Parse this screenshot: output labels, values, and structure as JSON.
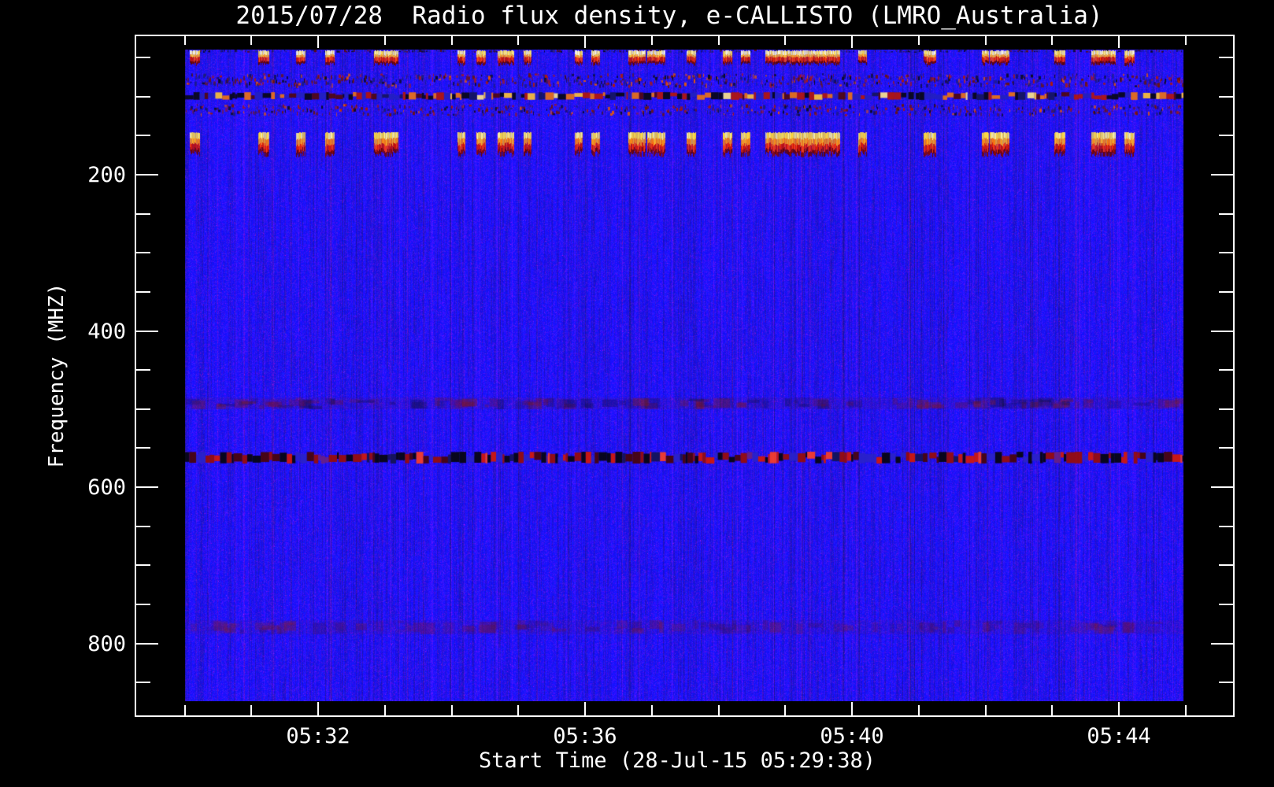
{
  "title": "2015/07/28  Radio flux density, e-CALLISTO (LMRO_Australia)",
  "axes": {
    "x": {
      "label": "Start Time (28-Jul-15 05:29:38)",
      "start_time": "05:29:38",
      "major_tick_labels": [
        "05:32",
        "05:36",
        "05:40",
        "05:44"
      ],
      "minor_tick_interval_min": 1,
      "major_tick_interval_min": 4
    },
    "y": {
      "label": "Frequency (MHZ)",
      "major_tick_labels": [
        "200",
        "400",
        "600",
        "800"
      ],
      "major_ticks_mhz": [
        200,
        400,
        600,
        800
      ],
      "minor_tick_step_mhz": 50,
      "direction": "frequency increases downward"
    }
  },
  "chart_data": {
    "type": "heatmap",
    "title": "2015/07/28  Radio flux density, e-CALLISTO (LMRO_Australia)",
    "xlabel": "Start Time (28-Jul-15 05:29:38)",
    "ylabel": "Frequency (MHZ)",
    "x_range": [
      "05:29:38",
      "05:45:15"
    ],
    "y_range_mhz": [
      40,
      874
    ],
    "x_ticks": [
      "05:32",
      "05:36",
      "05:40",
      "05:44"
    ],
    "y_ticks_mhz": [
      200,
      400,
      600,
      800
    ],
    "legend": "none",
    "grid": "off",
    "colormap": "blue (quiet) -> dark red -> red -> orange -> yellow -> white (strong flux)",
    "background": {
      "base_color": "#2316f0",
      "description": "quiet radio background: saturated blue with vertical noise striping and sparse purple/red flecks"
    },
    "burst_x_frac": [
      [
        0.005,
        0.015
      ],
      [
        0.073,
        0.084
      ],
      [
        0.111,
        0.121
      ],
      [
        0.14,
        0.15
      ],
      [
        0.189,
        0.214
      ],
      [
        0.273,
        0.281
      ],
      [
        0.292,
        0.301
      ],
      [
        0.313,
        0.33
      ],
      [
        0.339,
        0.347
      ],
      [
        0.39,
        0.398
      ],
      [
        0.407,
        0.416
      ],
      [
        0.444,
        0.461
      ],
      [
        0.463,
        0.481
      ],
      [
        0.502,
        0.512
      ],
      [
        0.539,
        0.548
      ],
      [
        0.557,
        0.566
      ],
      [
        0.581,
        0.656
      ],
      [
        0.674,
        0.683
      ],
      [
        0.74,
        0.752
      ],
      [
        0.798,
        0.805
      ],
      [
        0.806,
        0.826
      ],
      [
        0.871,
        0.882
      ],
      [
        0.908,
        0.932
      ],
      [
        0.941,
        0.951
      ]
    ],
    "features": [
      {
        "name": "top-edge-noise",
        "type": "speckle",
        "freq_mhz": [
          40,
          44
        ],
        "density": 0.35,
        "min_h": 1,
        "max_h": 3,
        "palette": [
          [
            "#0a0a28",
            5
          ],
          [
            "#26268c",
            4
          ],
          [
            "#5a0c10",
            2
          ]
        ]
      },
      {
        "name": "burst-row-45mhz",
        "type": "blobs",
        "freq_mhz": [
          41,
          58
        ],
        "layers": [
          {
            "h": 0.3,
            "colors": [
              "#fffce4",
              "#fff0a0",
              "#ffe14e"
            ]
          },
          {
            "h": 0.18,
            "colors": [
              "#ffc83c",
              "#ffa01e"
            ]
          },
          {
            "h": 0.32,
            "colors": [
              "#e62500",
              "#ff4c10",
              "#c81400"
            ]
          },
          {
            "h": 0.2,
            "colors": [
              "#7c0800",
              "#5c0300"
            ]
          }
        ]
      },
      {
        "name": "speckle-band-80mhz",
        "type": "speckle",
        "freq_mhz": [
          70,
          89
        ],
        "density": 0.55,
        "min_h": 2,
        "max_h": 6,
        "palette": [
          [
            "#6c1410",
            3
          ],
          [
            "#b01a08",
            2
          ],
          [
            "#e0560e",
            1
          ],
          [
            "#0c0c22",
            2.5
          ],
          [
            "#1c1c80",
            2
          ]
        ]
      },
      {
        "name": "rfi-line-100mhz",
        "type": "dashes",
        "freq_mhz": [
          94,
          104
        ],
        "palette": [
          [
            "#08080f",
            22
          ],
          [
            "#52080a",
            12
          ],
          [
            "#b81604",
            12
          ],
          [
            "#ef7410",
            16
          ],
          [
            "#ffc434",
            11
          ],
          [
            "#ffe88a",
            4
          ],
          [
            "#2220c0",
            18
          ],
          [
            "#15155a",
            5
          ]
        ]
      },
      {
        "name": "speckle-band-115mhz",
        "type": "speckle",
        "freq_mhz": [
          109,
          125
        ],
        "density": 0.45,
        "min_h": 2,
        "max_h": 5,
        "palette": [
          [
            "#6c1410",
            3
          ],
          [
            "#a81808",
            2
          ],
          [
            "#e0560e",
            0.8
          ],
          [
            "#0c0c22",
            2
          ],
          [
            "#1c1c80",
            2
          ]
        ]
      },
      {
        "name": "burst-row-160mhz",
        "type": "blobs",
        "freq_mhz": [
          146,
          174
        ],
        "layers": [
          {
            "h": 0.28,
            "colors": [
              "#fff6a0",
              "#ffe34e",
              "#ffd83a"
            ]
          },
          {
            "h": 0.26,
            "colors": [
              "#ff9612",
              "#ff7c0a",
              "#ffb224"
            ]
          },
          {
            "h": 0.26,
            "colors": [
              "#e01c00",
              "#c81200",
              "#ff3c0c"
            ]
          },
          {
            "h": 0.2,
            "colors": [
              "#8a0800",
              "#640300"
            ]
          }
        ]
      },
      {
        "name": "faint-band-490mhz",
        "type": "smudge",
        "freq_mhz": [
          485,
          500
        ],
        "count": 140,
        "strip_alpha": 0.1,
        "alpha": [
          0.12,
          0.38
        ],
        "colors": [
          "#7c1028",
          "#8c1c14",
          "#101040"
        ]
      },
      {
        "name": "interference-band-560mhz",
        "type": "dashes",
        "freq_mhz": [
          555,
          570
        ],
        "palette": [
          [
            "#050508",
            26
          ],
          [
            "#4a0400",
            16
          ],
          [
            "#9c0c00",
            17
          ],
          [
            "#d81800",
            11
          ],
          [
            "#ff4020",
            5
          ],
          [
            "#2a22c8",
            14
          ],
          [
            "#141450",
            8
          ],
          [
            "#6c2080",
            3
          ]
        ]
      },
      {
        "name": "faint-band-780mhz",
        "type": "smudge",
        "freq_mhz": [
          770,
          788
        ],
        "count": 110,
        "strip_alpha": 0.08,
        "alpha": [
          0.1,
          0.32
        ],
        "colors": [
          "#8c1c1c",
          "#7c1028",
          "#3c1050"
        ]
      }
    ]
  },
  "colors": {
    "page_background": "#000000",
    "frame": "#ffffff",
    "text": "#ffffff"
  }
}
